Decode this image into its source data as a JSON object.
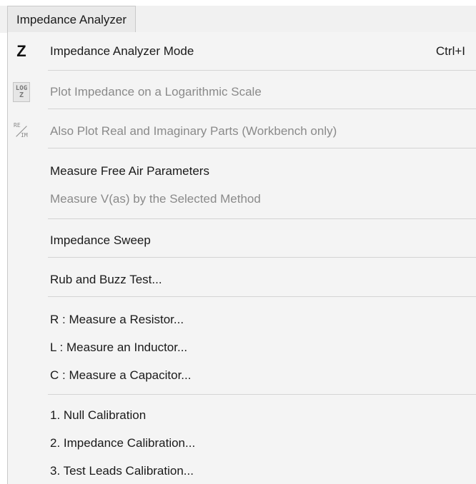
{
  "menu": {
    "title": "Impedance Analyzer"
  },
  "items": [
    {
      "label": "Impedance Analyzer Mode",
      "shortcut": "Ctrl+I",
      "icon": "z-icon",
      "disabled": false
    },
    {
      "label": "Plot Impedance on a Logarithmic Scale",
      "icon": "log-z-icon",
      "disabled": true
    },
    {
      "label": "Also Plot Real and Imaginary Parts (Workbench only)",
      "icon": "re-im-icon",
      "disabled": true
    },
    {
      "label": "Measure Free Air Parameters",
      "disabled": false
    },
    {
      "label": "Measure V(as) by the Selected Method",
      "disabled": true
    },
    {
      "label": "Impedance Sweep",
      "disabled": false
    },
    {
      "label": "Rub and Buzz Test...",
      "disabled": false
    },
    {
      "label": "R : Measure a Resistor...",
      "disabled": false
    },
    {
      "label": "L : Measure an Inductor...",
      "disabled": false
    },
    {
      "label": "C : Measure a Capacitor...",
      "disabled": false
    },
    {
      "label": "1. Null Calibration",
      "disabled": false
    },
    {
      "label": "2. Impedance Calibration...",
      "disabled": false
    },
    {
      "label": "3. Test Leads Calibration...",
      "disabled": false
    }
  ],
  "icons": {
    "z": "Z",
    "log_top": "LOG",
    "log_bottom": "Z",
    "re": "RE",
    "im": "IM"
  },
  "colors": {
    "menu_background": "#f4f4f4",
    "disabled_text": "#8a8a8a",
    "separator": "#d4d4d4"
  }
}
